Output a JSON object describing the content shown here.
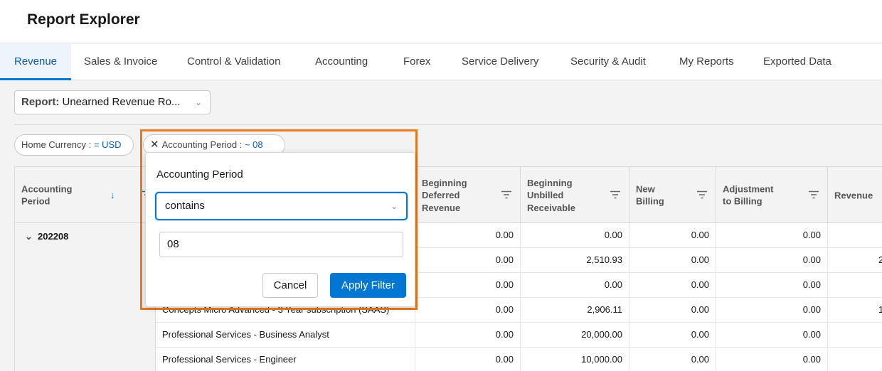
{
  "app": {
    "title": "Report Explorer"
  },
  "tabs": [
    {
      "label": "Revenue",
      "active": true
    },
    {
      "label": "Sales & Invoice"
    },
    {
      "label": "Control & Validation"
    },
    {
      "label": "Accounting"
    },
    {
      "label": "Forex"
    },
    {
      "label": "Service Delivery"
    },
    {
      "label": "Security & Audit"
    },
    {
      "label": "My Reports"
    },
    {
      "label": "Exported Data"
    }
  ],
  "report_select": {
    "label": "Report:",
    "value": "Unearned Revenue Ro...",
    "icon": "chevron-down-icon"
  },
  "filters": [
    {
      "label": "Home Currency : ",
      "value": "= USD"
    },
    {
      "label": "Accounting Period : ",
      "value": "~ 08",
      "icon": "close-icon"
    }
  ],
  "table": {
    "columns": [
      "Accounting\nPeriod",
      "Beginning\nDeferred\nRevenue",
      "Beginning\nUnbilled\nReceivable",
      "New\nBilling",
      "Adjustment\nto Billing",
      "Revenue"
    ],
    "group": "202208",
    "rows": [
      {
        "product": "",
        "values": [
          "0.00",
          "0.00",
          "0.00",
          "0.00"
        ]
      },
      {
        "product": "",
        "values": [
          "0.00",
          "2,510.93",
          "0.00",
          "0.00"
        ],
        "revenue_partial": "2"
      },
      {
        "product": "",
        "values": [
          "0.00",
          "0.00",
          "0.00",
          "0.00"
        ]
      },
      {
        "product": "Concepts Micro Advanced - 3 Year subscription (SAAS)",
        "values": [
          "0.00",
          "2,906.11",
          "0.00",
          "0.00"
        ],
        "revenue_partial": "1"
      },
      {
        "product": "Professional Services - Business Analyst",
        "values": [
          "0.00",
          "20,000.00",
          "0.00",
          "0.00"
        ]
      },
      {
        "product": "Professional Services - Engineer",
        "values": [
          "0.00",
          "10,000.00",
          "0.00",
          "0.00"
        ]
      }
    ]
  },
  "filter_popover": {
    "title": "Accounting Period",
    "operator": "contains",
    "value": "08",
    "cancel_label": "Cancel",
    "apply_label": "Apply Filter"
  },
  "colors": {
    "accent": "#0176d3",
    "highlight_border": "#e87a1f",
    "link": "#0b5cab"
  }
}
